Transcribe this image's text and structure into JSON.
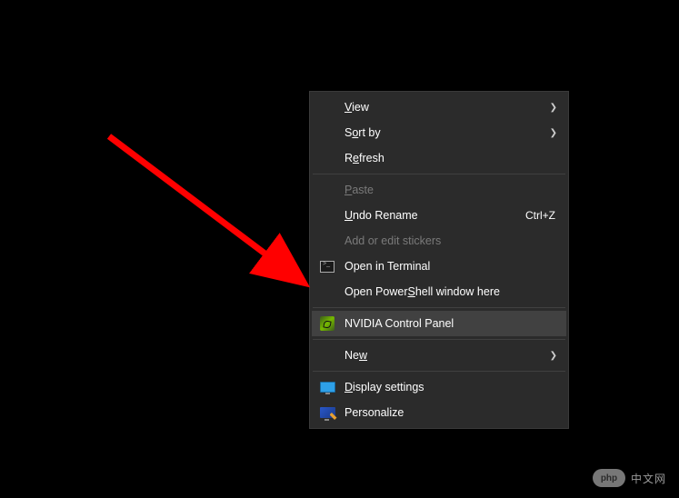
{
  "menu": {
    "view": {
      "label": "View",
      "underline": "V",
      "hasSubmenu": true
    },
    "sort": {
      "label": "Sort by",
      "underline": "o",
      "hasSubmenu": true
    },
    "refresh": {
      "label": "Refresh",
      "underline": "e"
    },
    "paste": {
      "label": "Paste",
      "underline": "P",
      "disabled": true
    },
    "undo": {
      "label": "Undo Rename",
      "underline": "U",
      "shortcut": "Ctrl+Z"
    },
    "stickers": {
      "label": "Add or edit stickers",
      "disabled": true
    },
    "terminal": {
      "label": "Open in Terminal",
      "icon": "terminal-icon"
    },
    "powershell": {
      "label": "Open PowerShell window here",
      "underline": "S"
    },
    "nvidia": {
      "label": "NVIDIA Control Panel",
      "icon": "nvidia-icon",
      "highlighted": true
    },
    "new": {
      "label": "New",
      "underline": "w",
      "hasSubmenu": true
    },
    "display": {
      "label": "Display settings",
      "underline": "D",
      "icon": "display-icon"
    },
    "personalize": {
      "label": "Personalize",
      "icon": "personalize-icon"
    }
  },
  "arrow": {
    "color": "#ff0000"
  },
  "watermark": {
    "badge": "php",
    "text": "中文网"
  }
}
